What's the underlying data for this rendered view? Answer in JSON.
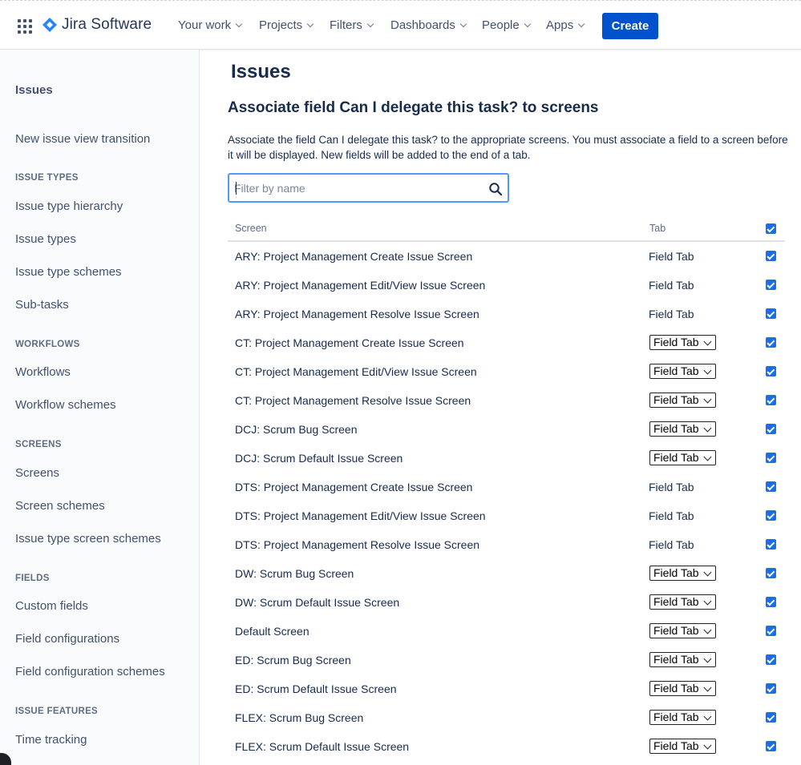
{
  "header": {
    "app_name": "Jira Software",
    "nav": [
      {
        "label": "Your work",
        "has_menu": true
      },
      {
        "label": "Projects",
        "has_menu": true
      },
      {
        "label": "Filters",
        "has_menu": true
      },
      {
        "label": "Dashboards",
        "has_menu": true
      },
      {
        "label": "People",
        "has_menu": true
      },
      {
        "label": "Apps",
        "has_menu": true
      }
    ],
    "create_label": "Create",
    "brand_color": "#0052CC"
  },
  "sidebar": {
    "title": "Issues",
    "new_issue_view": "New issue view transition",
    "sections": [
      {
        "heading": "ISSUE TYPES",
        "items": [
          "Issue type hierarchy",
          "Issue types",
          "Issue type schemes",
          "Sub-tasks"
        ]
      },
      {
        "heading": "WORKFLOWS",
        "items": [
          "Workflows",
          "Workflow schemes"
        ]
      },
      {
        "heading": "SCREENS",
        "items": [
          "Screens",
          "Screen schemes",
          "Issue type screen schemes"
        ]
      },
      {
        "heading": "FIELDS",
        "items": [
          "Custom fields",
          "Field configurations",
          "Field configuration schemes"
        ]
      },
      {
        "heading": "ISSUE FEATURES",
        "items": [
          "Time tracking"
        ]
      }
    ]
  },
  "main": {
    "page_title": "Issues",
    "heading": "Associate field Can I delegate this task? to screens",
    "description": "Associate the field Can I delegate this task? to the appropriate screens. You must associate a field to a screen before it will be displayed. New fields will be added to the end of a tab.",
    "filter_placeholder": "Filter by name",
    "filter_value": "",
    "columns": {
      "screen": "Screen",
      "tab": "Tab",
      "select_all_checked": true
    },
    "rows": [
      {
        "screen": "ARY: Project Management Create Issue Screen",
        "tab": "Field Tab",
        "tab_dropdown": false,
        "checked": true
      },
      {
        "screen": "ARY: Project Management Edit/View Issue Screen",
        "tab": "Field Tab",
        "tab_dropdown": false,
        "checked": true
      },
      {
        "screen": "ARY: Project Management Resolve Issue Screen",
        "tab": "Field Tab",
        "tab_dropdown": false,
        "checked": true
      },
      {
        "screen": "CT: Project Management Create Issue Screen",
        "tab": "Field Tab",
        "tab_dropdown": true,
        "checked": true
      },
      {
        "screen": "CT: Project Management Edit/View Issue Screen",
        "tab": "Field Tab",
        "tab_dropdown": true,
        "checked": true
      },
      {
        "screen": "CT: Project Management Resolve Issue Screen",
        "tab": "Field Tab",
        "tab_dropdown": true,
        "checked": true
      },
      {
        "screen": "DCJ: Scrum Bug Screen",
        "tab": "Field Tab",
        "tab_dropdown": true,
        "checked": true
      },
      {
        "screen": "DCJ: Scrum Default Issue Screen",
        "tab": "Field Tab",
        "tab_dropdown": true,
        "checked": true
      },
      {
        "screen": "DTS: Project Management Create Issue Screen",
        "tab": "Field Tab",
        "tab_dropdown": false,
        "checked": true
      },
      {
        "screen": "DTS: Project Management Edit/View Issue Screen",
        "tab": "Field Tab",
        "tab_dropdown": false,
        "checked": true
      },
      {
        "screen": "DTS: Project Management Resolve Issue Screen",
        "tab": "Field Tab",
        "tab_dropdown": false,
        "checked": true
      },
      {
        "screen": "DW: Scrum Bug Screen",
        "tab": "Field Tab",
        "tab_dropdown": true,
        "checked": true
      },
      {
        "screen": "DW: Scrum Default Issue Screen",
        "tab": "Field Tab",
        "tab_dropdown": true,
        "checked": true
      },
      {
        "screen": "Default Screen",
        "tab": "Field Tab",
        "tab_dropdown": true,
        "checked": true
      },
      {
        "screen": "ED: Scrum Bug Screen",
        "tab": "Field Tab",
        "tab_dropdown": true,
        "checked": true
      },
      {
        "screen": "ED: Scrum Default Issue Screen",
        "tab": "Field Tab",
        "tab_dropdown": true,
        "checked": true
      },
      {
        "screen": "FLEX: Scrum Bug Screen",
        "tab": "Field Tab",
        "tab_dropdown": true,
        "checked": true
      },
      {
        "screen": "FLEX: Scrum Default Issue Screen",
        "tab": "Field Tab",
        "tab_dropdown": true,
        "checked": true
      }
    ]
  }
}
